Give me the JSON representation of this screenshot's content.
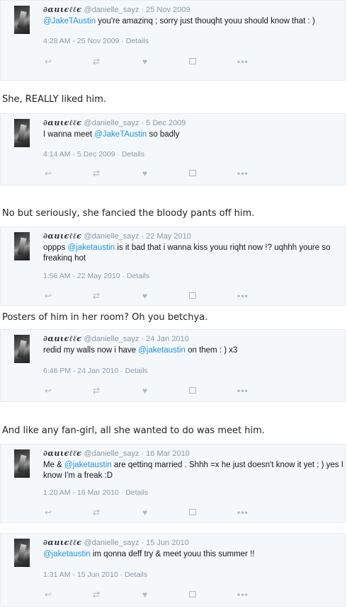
{
  "captions": [
    "She, REALLY liked him.",
    "No but seriously, she fancied the bloody pants off him.",
    "Posters of him in her room? Oh you betchya.",
    "And like any fan-girl, all she wanted to do was meet him."
  ],
  "tweets": [
    {
      "display_name": "∂αиιєℓℓє",
      "handle": "@danielle_sayz",
      "sep": " · ",
      "date": "25 Nov 2009",
      "segments": [
        {
          "text": "@JakeTAustin",
          "mention": true
        },
        {
          "text": " you're amazinq ; sorry just thouqht youu should know that : )",
          "mention": false
        }
      ],
      "timestamp": "4:28 AM - 25 Nov 2009 · Details"
    },
    {
      "display_name": "∂αиιєℓℓє",
      "handle": "@danielle_sayz",
      "sep": " · ",
      "date": "5 Dec 2009",
      "segments": [
        {
          "text": "I wanna meet ",
          "mention": false
        },
        {
          "text": "@JakeTAustin",
          "mention": true
        },
        {
          "text": " so badly",
          "mention": false
        }
      ],
      "timestamp": "4:14 AM - 5 Dec 2009 · Details"
    },
    {
      "display_name": "∂αиιєℓℓє",
      "handle": "@danielle_sayz",
      "sep": " · ",
      "date": "22 May 2010",
      "segments": [
        {
          "text": "oppps ",
          "mention": false
        },
        {
          "text": "@jaketaustin",
          "mention": true
        },
        {
          "text": " is it bad that i wanna kiss youu riqht now !? uqhhh youre so freakinq hot",
          "mention": false
        }
      ],
      "timestamp": "1:56 AM - 22 May 2010 · Details"
    },
    {
      "display_name": "∂αиιєℓℓє",
      "handle": "@danielle_sayz",
      "sep": " · ",
      "date": "24 Jan 2010",
      "segments": [
        {
          "text": "redid my walls now i have ",
          "mention": false
        },
        {
          "text": "@jaketaustin",
          "mention": true
        },
        {
          "text": " on them : ) x3",
          "mention": false
        }
      ],
      "timestamp": "6:46 PM - 24 Jan 2010 · Details"
    },
    {
      "display_name": "∂αиιєℓℓє",
      "handle": "@danielle_sayz",
      "sep": " · ",
      "date": "16 Mar 2010",
      "segments": [
        {
          "text": "Me & ",
          "mention": false
        },
        {
          "text": "@jaketaustin",
          "mention": true
        },
        {
          "text": " are qettinq married . Shhh =x he just doesn't know it yet ; ) yes I know I'm a freak :D",
          "mention": false
        }
      ],
      "timestamp": "1:20 AM - 16 Mar 2010 · Details"
    },
    {
      "display_name": "∂αиιєℓℓє",
      "handle": "@danielle_sayz",
      "sep": " · ",
      "date": "15 Jun 2010",
      "segments": [
        {
          "text": "@jaketaustin",
          "mention": true
        },
        {
          "text": " im qonna deff try & meet youu this summer !!",
          "mention": false
        }
      ],
      "timestamp": "1:31 AM - 15 Jun 2010 · Details"
    }
  ],
  "icons": {
    "reply": "reply-icon",
    "retweet": "retweet-icon",
    "like": "heart-icon",
    "save": "save-icon",
    "more": "more-icon"
  },
  "glyphs": {
    "reply": "↩",
    "retweet": "⇄",
    "like": "♥",
    "more": "•••"
  },
  "colors": {
    "mention": "#1b95e0",
    "card_background": "#f5f8fa",
    "muted_text": "#8899a6"
  }
}
